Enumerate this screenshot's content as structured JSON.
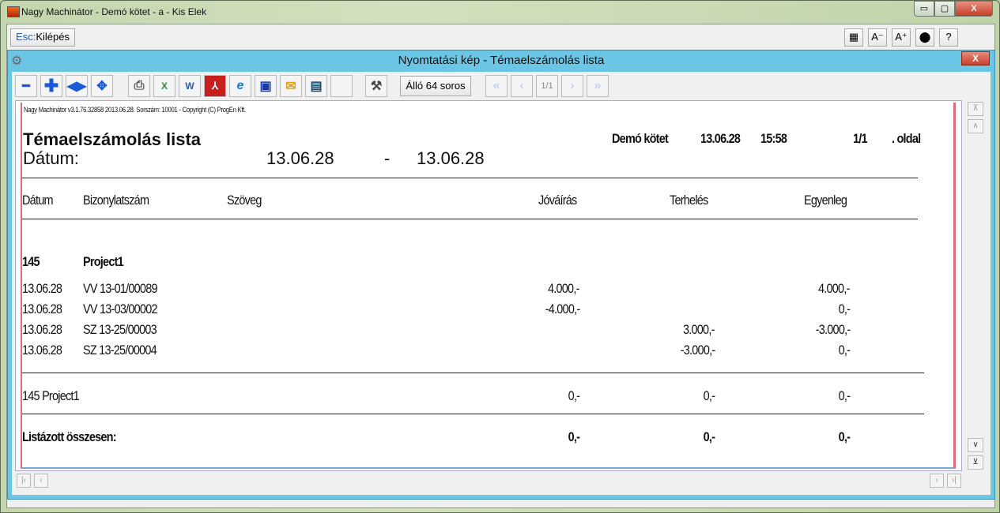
{
  "window": {
    "title": "Nagy Machinátor - Demó kötet - a - Kis Elek",
    "min": "▭",
    "max": "▢",
    "close": "X"
  },
  "topbar": {
    "esc_key": "Esc:",
    "esc_label": "Kilépés",
    "buttons": [
      "▦",
      "A⁻",
      "A⁺",
      "⬤",
      "?"
    ]
  },
  "dialog": {
    "title": "Nyomtatási kép - Témaelszámolás lista",
    "close": "X"
  },
  "toolbar": {
    "orientation": "Álló 64 soros",
    "page": "1/1"
  },
  "report": {
    "header_line": "Nagy Machinátor v3.1.76.32858 2013.06.28. Sorszám: 10001 - Copyright (C) ProgEn Kft.",
    "title": "Témaelszámolás lista",
    "date_label": "Dátum:",
    "date_from": "13.06.28",
    "date_sep": "-",
    "date_to": "13.06.28",
    "volume": "Demó kötet",
    "print_date": "13.06.28",
    "print_time": "15:58",
    "page": "1/1",
    "page_suffix": ". oldal",
    "columns": [
      "Dátum",
      "Bizonylatszám",
      "Szöveg",
      "Jóváírás",
      "Terhelés",
      "Egyenleg"
    ],
    "group": {
      "code": "145",
      "name": "Project1"
    },
    "rows": [
      {
        "date": "13.06.28",
        "doc": "VV 13-01/00089",
        "credit": "4.000,-",
        "debit": "",
        "balance": "4.000,-"
      },
      {
        "date": "13.06.28",
        "doc": "VV 13-03/00002",
        "credit": "-4.000,-",
        "debit": "",
        "balance": "0,-"
      },
      {
        "date": "13.06.28",
        "doc": "SZ 13-25/00003",
        "credit": "",
        "debit": "3.000,-",
        "balance": "-3.000,-"
      },
      {
        "date": "13.06.28",
        "doc": "SZ 13-25/00004",
        "credit": "",
        "debit": "-3.000,-",
        "balance": "0,-"
      }
    ],
    "subtotal": {
      "label": "145 Project1",
      "credit": "0,-",
      "debit": "0,-",
      "balance": "0,-"
    },
    "total": {
      "label": "Listázott összesen:",
      "credit": "0,-",
      "debit": "0,-",
      "balance": "0,-"
    }
  }
}
